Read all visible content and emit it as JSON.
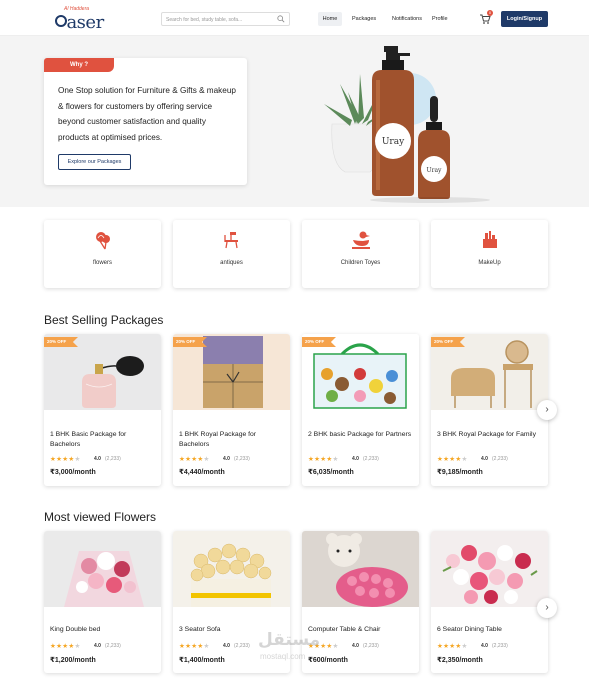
{
  "header": {
    "logo_tag": "Al Haddera",
    "logo_word": "aser",
    "search_placeholder": "Search for bed, study table, sofa...",
    "nav": [
      "Home",
      "Packages",
      "Notifications",
      "Profile"
    ],
    "cart_count": "0",
    "login_label": "Login/Signup",
    "accent": "#1f3a68"
  },
  "hero": {
    "tab": "Why ?",
    "text": "One Stop solution for Furniture & Gifts & makeup & flowers  for customers by offering service beyond customer satisfaction and quality products at optimised prices.",
    "button": "Explore our Packages",
    "bottle_label": "Uray",
    "bottle_label_small": "Uray"
  },
  "categories": [
    {
      "label": "flowers",
      "icon": "flowers-icon"
    },
    {
      "label": "antiques",
      "icon": "furniture-icon"
    },
    {
      "label": "Children Toyes",
      "icon": "toy-duck-icon"
    },
    {
      "label": "MakeUp",
      "icon": "makeup-icon"
    }
  ],
  "best_selling": {
    "title": "Best Selling Packages",
    "items": [
      {
        "discount": "20% OFF",
        "name": "1 BHK Basic Package for Bachelors",
        "rating": "4.0",
        "count": "(2,233)",
        "stars": 4,
        "price": "₹3,000/month",
        "image": "perfume"
      },
      {
        "discount": "20% OFF",
        "name": "1 BHK Royal Package for Bachelors",
        "rating": "4.0",
        "count": "(2,233)",
        "stars": 4,
        "price": "₹4,440/month",
        "image": "gift-box"
      },
      {
        "discount": "20% OFF",
        "name": "2 BHK basic Package for Partners",
        "rating": "4.0",
        "count": "(2,233)",
        "stars": 4,
        "price": "₹6,035/month",
        "image": "toy-bag"
      },
      {
        "discount": "20% OFF",
        "name": "3 BHK Royal Package for Family",
        "rating": "4.0",
        "count": "(2,233)",
        "stars": 4,
        "price": "₹9,185/month",
        "image": "rattan-furniture"
      }
    ]
  },
  "most_viewed": {
    "title": "Most viewed Flowers",
    "items": [
      {
        "name": "King Double bed",
        "rating": "4.0",
        "count": "(2,233)",
        "stars": 4,
        "price": "₹1,200/month",
        "image": "bouquet"
      },
      {
        "name": "3 Seator Sofa",
        "rating": "4.0",
        "count": "(2,233)",
        "stars": 4,
        "price": "₹1,400/month",
        "image": "rose-box"
      },
      {
        "name": "Computer Table & Chair",
        "rating": "4.0",
        "count": "(2,233)",
        "stars": 4,
        "price": "₹600/month",
        "image": "teddy-roses"
      },
      {
        "name": "6 Seator Dining Table",
        "rating": "4.0",
        "count": "(2,233)",
        "stars": 4,
        "price": "₹2,350/month",
        "image": "pink-bouquet"
      }
    ]
  },
  "watermark": {
    "arabic": "مستقل",
    "latin": "mostaql.com"
  }
}
